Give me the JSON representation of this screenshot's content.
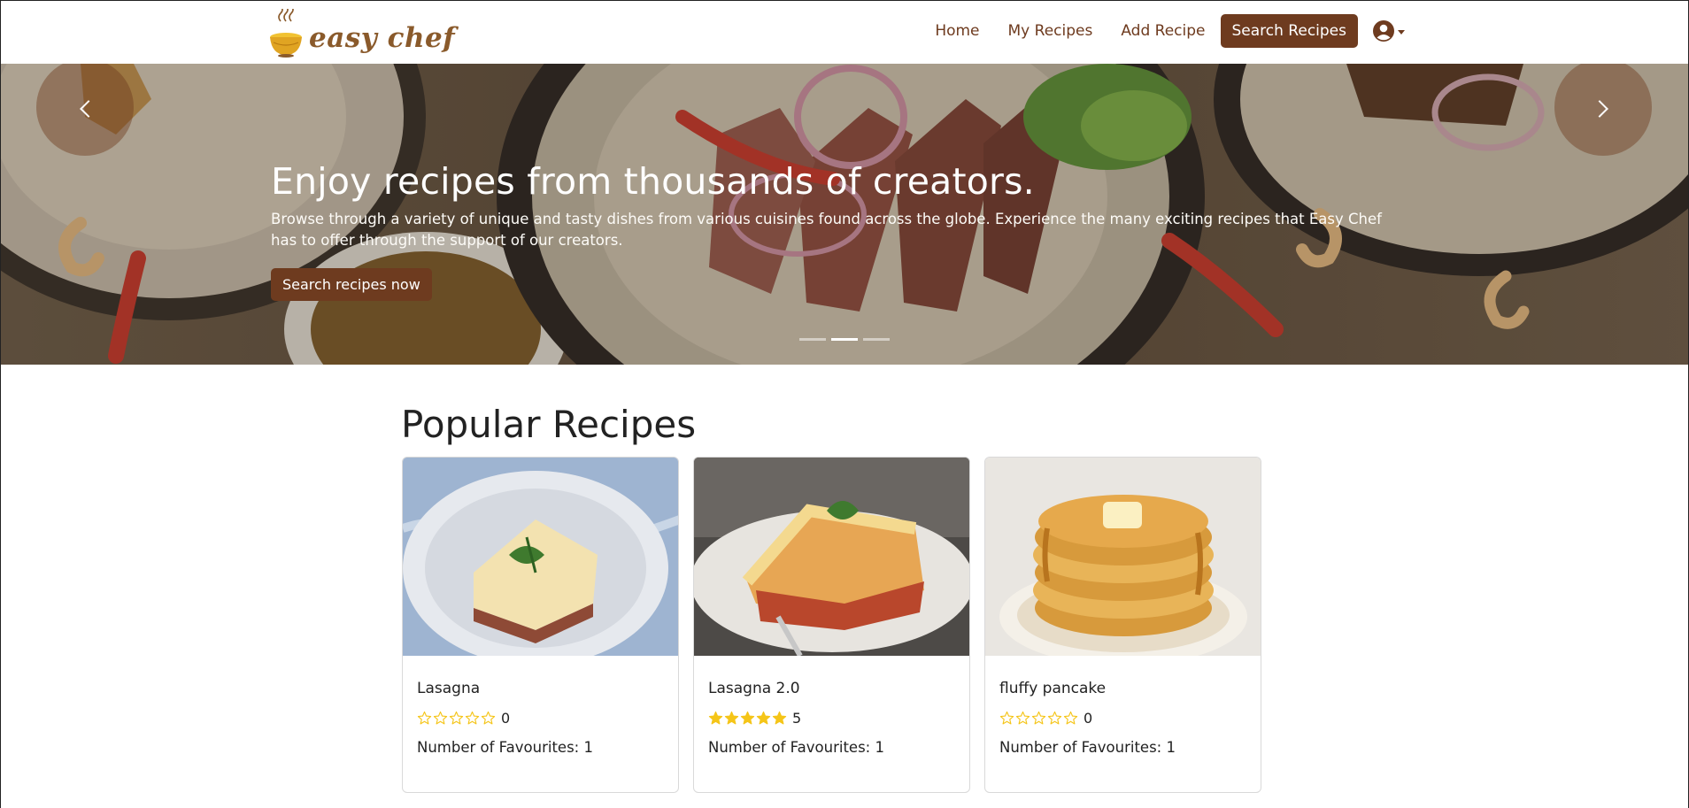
{
  "brand": {
    "name": "easy chef",
    "color": "#8a5a2b"
  },
  "nav": {
    "links": [
      "Home",
      "My Recipes",
      "Add Recipe"
    ],
    "cta": "Search Recipes",
    "user_icon": "user-circle-icon",
    "accent": "#6e3b1f"
  },
  "hero": {
    "title": "Enjoy recipes from thousands of creators.",
    "subtitle": "Browse through a variety of unique and tasty dishes from various cuisines found across the globe. Experience the many exciting recipes that Easy Chef has to offer through the support of our creators.",
    "button": "Search recipes now",
    "slides": 3,
    "active_slide": 2
  },
  "popular": {
    "title": "Popular Recipes",
    "favourites_label": "Number of Favourites: ",
    "recipes": [
      {
        "name": "Lasagna",
        "rating": 0,
        "rating_text": "0",
        "favourites": "1",
        "image": "lasagna-photo"
      },
      {
        "name": "Lasagna 2.0",
        "rating": 5,
        "rating_text": "5",
        "favourites": "1",
        "image": "lasagna-photo"
      },
      {
        "name": "fluffy pancake",
        "rating": 0,
        "rating_text": "0",
        "favourites": "1",
        "image": "pancake-photo"
      }
    ]
  },
  "colors": {
    "star": "#f5c518",
    "accent": "#6e3b1f",
    "text": "#222222"
  }
}
